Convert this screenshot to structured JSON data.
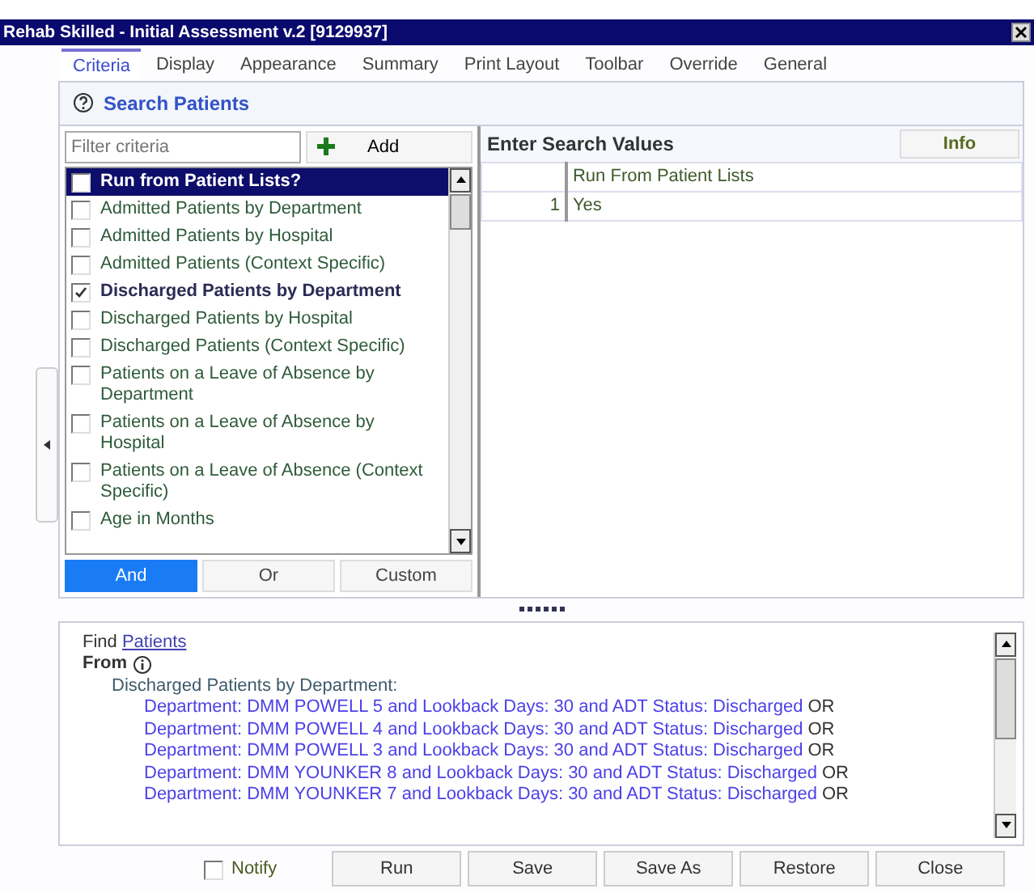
{
  "window": {
    "title": "Rehab Skilled - Initial Assessment v.2 [9129937]"
  },
  "tabs": [
    {
      "label": "Criteria",
      "selected": true
    },
    {
      "label": "Display",
      "selected": false
    },
    {
      "label": "Appearance",
      "selected": false
    },
    {
      "label": "Summary",
      "selected": false
    },
    {
      "label": "Print Layout",
      "selected": false
    },
    {
      "label": "Toolbar",
      "selected": false
    },
    {
      "label": "Override",
      "selected": false
    },
    {
      "label": "General",
      "selected": false
    }
  ],
  "section_title": "Search Patients",
  "filter": {
    "placeholder": "Filter criteria"
  },
  "add_button": "Add",
  "criteria": [
    {
      "label": "Run from Patient Lists?",
      "checked": false,
      "selected": true
    },
    {
      "label": "Admitted Patients by Department",
      "checked": false,
      "selected": false
    },
    {
      "label": "Admitted Patients by Hospital",
      "checked": false,
      "selected": false
    },
    {
      "label": "Admitted Patients (Context Specific)",
      "checked": false,
      "selected": false
    },
    {
      "label": "Discharged Patients by Department",
      "checked": true,
      "selected": false
    },
    {
      "label": "Discharged Patients by Hospital",
      "checked": false,
      "selected": false
    },
    {
      "label": "Discharged Patients (Context Specific)",
      "checked": false,
      "selected": false
    },
    {
      "label": "Patients on a Leave of Absence by Department",
      "checked": false,
      "selected": false
    },
    {
      "label": "Patients on a Leave of Absence by Hospital",
      "checked": false,
      "selected": false
    },
    {
      "label": "Patients on a Leave of Absence (Context Specific)",
      "checked": false,
      "selected": false
    },
    {
      "label": "Age in Months",
      "checked": false,
      "selected": false
    }
  ],
  "logic_buttons": [
    {
      "label": "And",
      "selected": true
    },
    {
      "label": "Or",
      "selected": false
    },
    {
      "label": "Custom",
      "selected": false
    }
  ],
  "values_panel": {
    "title": "Enter Search Values",
    "info_button": "Info",
    "columns": [
      "Run From Patient Lists"
    ],
    "rows": [
      {
        "number": "1",
        "value": "Yes"
      }
    ]
  },
  "summary": {
    "find": "Find",
    "find_link": "Patients",
    "from": "From",
    "group": "Discharged Patients by Department:",
    "lines": [
      {
        "text": "Department: DMM POWELL 5 and Lookback Days: 30 and ADT Status: Discharged",
        "connector": "OR"
      },
      {
        "text": "Department: DMM POWELL 4 and Lookback Days: 30 and ADT Status: Discharged",
        "connector": "OR"
      },
      {
        "text": "Department: DMM POWELL 3 and Lookback Days: 30 and ADT Status: Discharged",
        "connector": "OR"
      },
      {
        "text": "Department: DMM YOUNKER 8 and Lookback Days: 30 and ADT Status: Discharged",
        "connector": "OR"
      },
      {
        "text": "Department: DMM YOUNKER 7 and Lookback Days: 30 and ADT Status: Discharged",
        "connector": "OR"
      }
    ]
  },
  "notify": {
    "label": "Notify",
    "checked": false
  },
  "buttons": [
    "Run",
    "Save",
    "Save As",
    "Restore",
    "Close"
  ]
}
